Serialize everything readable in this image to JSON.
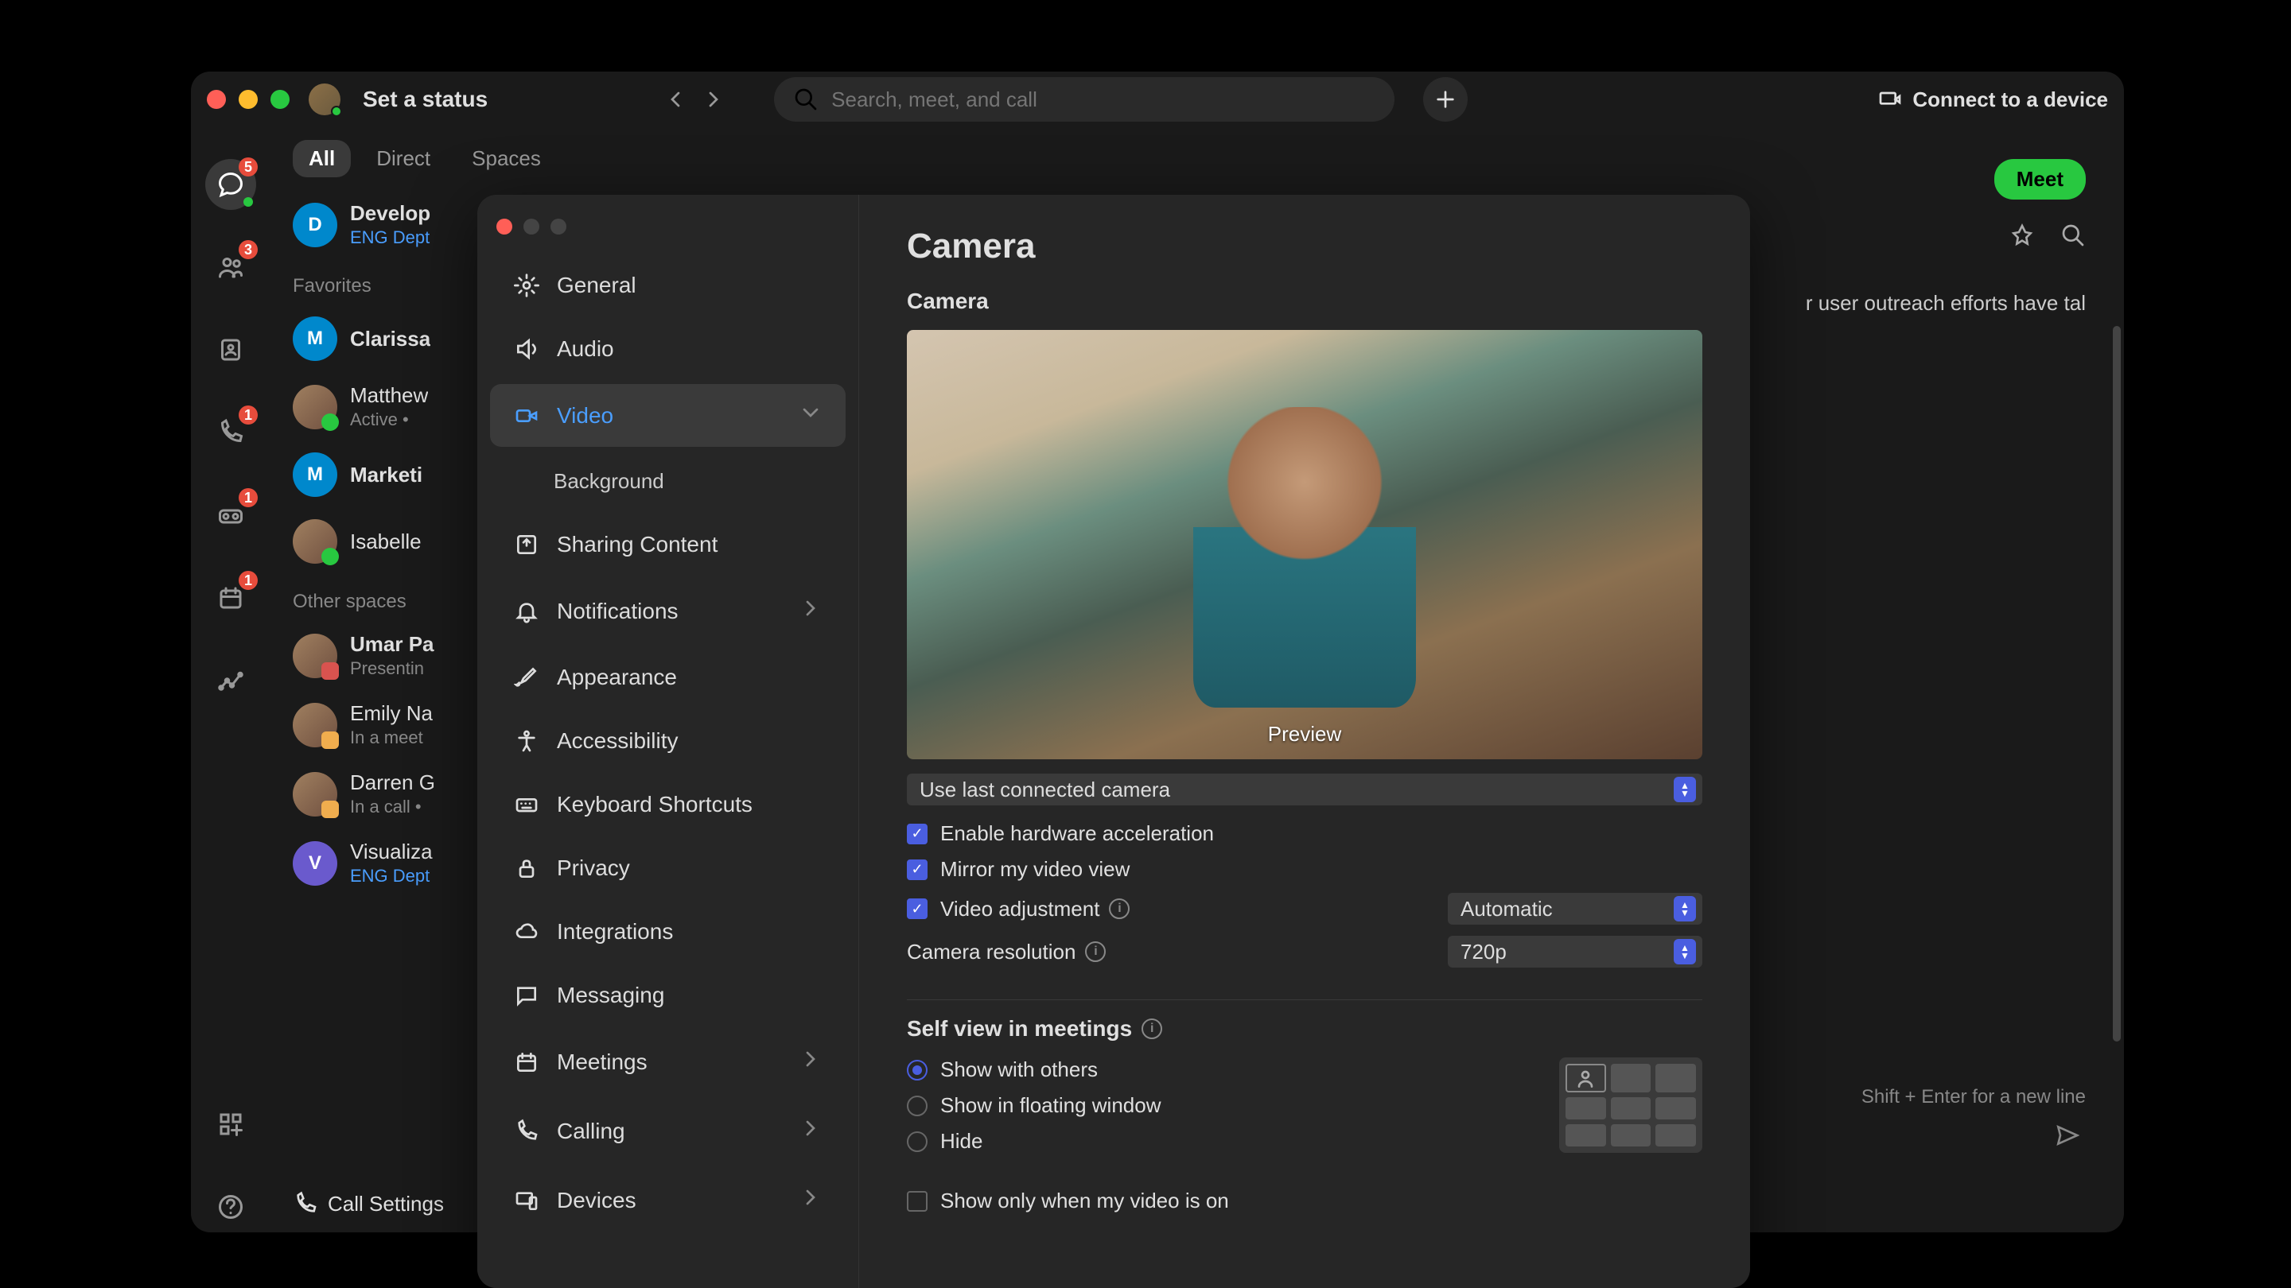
{
  "titlebar": {
    "set_status": "Set a status",
    "search_placeholder": "Search, meet, and call",
    "connect_device": "Connect to a device"
  },
  "nav_rail": {
    "chat_badge": "5",
    "contacts_badge": "3",
    "calls_badge": "1",
    "voicemail_badge": "1",
    "meetings_badge": "1"
  },
  "tabs": {
    "all": "All",
    "direct": "Direct",
    "spaces": "Spaces"
  },
  "sections": {
    "favorites": "Favorites",
    "other": "Other spaces"
  },
  "chats": {
    "dev": {
      "title": "Develop",
      "sub": "ENG Dept"
    },
    "clarissa": {
      "title": "Clarissa"
    },
    "matthew": {
      "title": "Matthew",
      "sub": "Active  •"
    },
    "marketing": {
      "title": "Marketi"
    },
    "isabelle": {
      "title": "Isabelle"
    },
    "umar": {
      "title": "Umar Pa",
      "sub": "Presentin"
    },
    "emily": {
      "title": "Emily Na",
      "sub": "In a meet"
    },
    "darren": {
      "title": "Darren G",
      "sub": "In a call  •"
    },
    "viz": {
      "title": "Visualiza",
      "sub": "ENG Dept"
    }
  },
  "call_settings": "Call Settings",
  "content": {
    "meet": "Meet",
    "bg_line": "r user outreach efforts have tal",
    "hint": "Shift + Enter for a new line"
  },
  "settings_nav": {
    "general": "General",
    "audio": "Audio",
    "video": "Video",
    "background": "Background",
    "sharing": "Sharing Content",
    "notifications": "Notifications",
    "appearance": "Appearance",
    "accessibility": "Accessibility",
    "keyboard": "Keyboard Shortcuts",
    "privacy": "Privacy",
    "integrations": "Integrations",
    "messaging": "Messaging",
    "meetings": "Meetings",
    "calling": "Calling",
    "devices": "Devices"
  },
  "settings": {
    "title": "Camera",
    "camera_h": "Camera",
    "preview": "Preview",
    "camera_select": "Use last connected camera",
    "hw_accel": "Enable hardware acceleration",
    "mirror": "Mirror my video view",
    "video_adj": "Video adjustment",
    "video_adj_val": "Automatic",
    "resolution": "Camera resolution",
    "resolution_val": "720p",
    "self_view_h": "Self view in meetings",
    "sv_with_others": "Show with others",
    "sv_floating": "Show in floating window",
    "sv_hide": "Hide",
    "show_only": "Show only when my video is on"
  }
}
